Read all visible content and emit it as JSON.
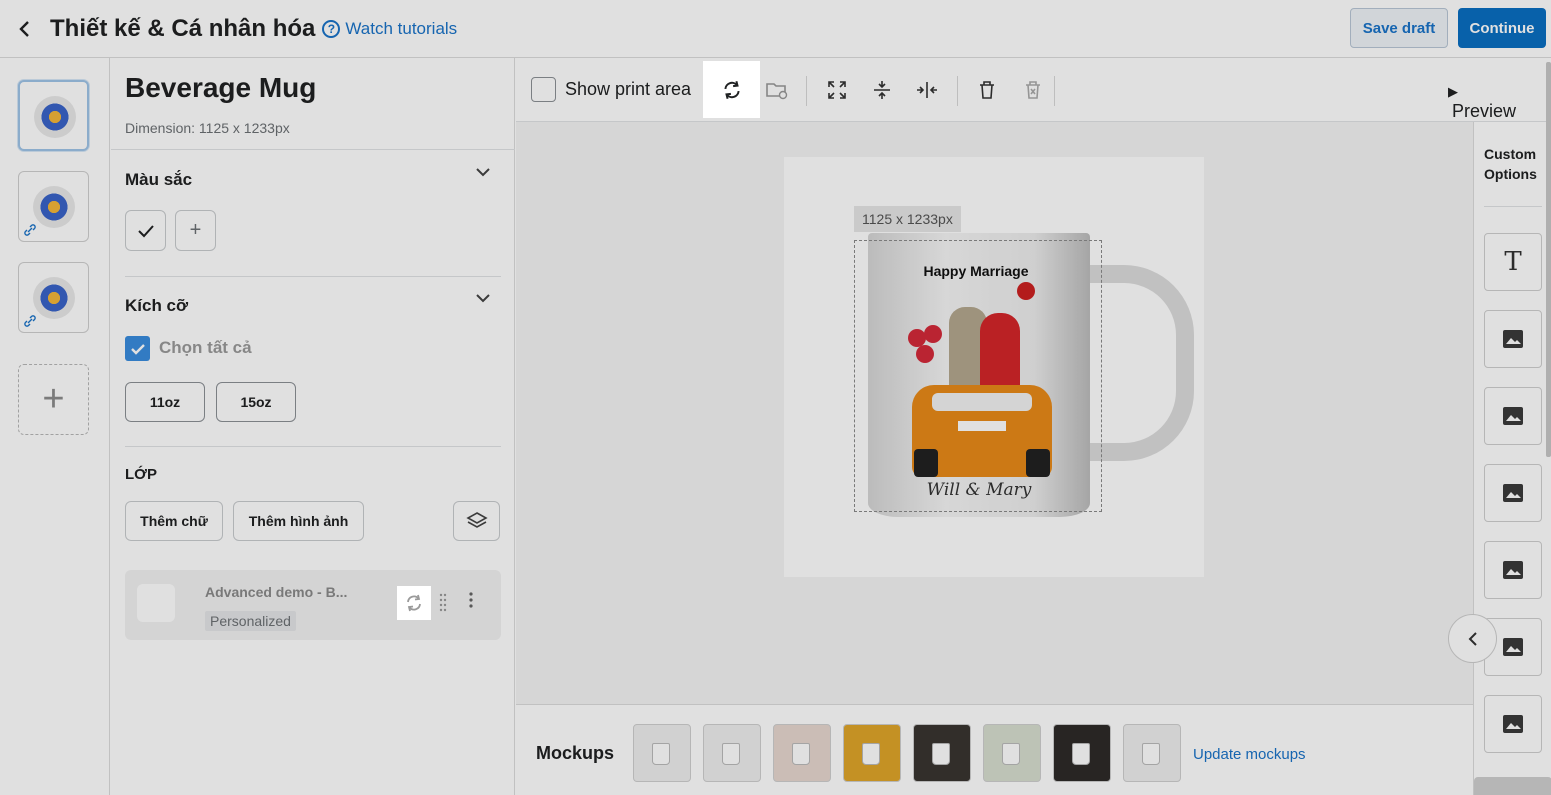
{
  "header": {
    "title": "Thiết kế & Cá nhân hóa",
    "help_icon": "question-circle-icon",
    "tutorials_label": "Watch tutorials",
    "save_draft_label": "Save draft",
    "continue_label": "Continue"
  },
  "product": {
    "name": "Beverage Mug",
    "dimension": "Dimension: 1125 x 1233px"
  },
  "color_section": {
    "title": "Màu sắc"
  },
  "size_section": {
    "title": "Kích cỡ",
    "select_all_label": "Chọn tất cả",
    "select_all_checked": true,
    "sizes": [
      "11oz",
      "15oz"
    ]
  },
  "layer_section": {
    "title": "LỚP",
    "add_text_label": "Thêm chữ",
    "add_image_label": "Thêm hình ảnh",
    "layers": [
      {
        "name": "Advanced demo - B...",
        "badge": "Personalized"
      }
    ]
  },
  "toolbar": {
    "show_print_area_label": "Show print area",
    "show_print_area_checked": false,
    "preview_label": "Preview"
  },
  "canvas": {
    "size_label": "1125 x 1233px",
    "art_title": "Happy Marriage",
    "art_signature": "Will & Mary"
  },
  "custom_options": {
    "title_line1": "Custom",
    "title_line2": "Options"
  },
  "mockups": {
    "label": "Mockups",
    "update_label": "Update mockups",
    "backgrounds": [
      "#eeeeee",
      "#eeeeee",
      "#e7d8d0",
      "#e0a62a",
      "#3a3530",
      "#d8dfd0",
      "#2e2b28",
      "#eeeeee"
    ]
  },
  "colors": {
    "accent": "#0a6fc2",
    "link": "#1a73c9",
    "checkbox": "#3a8dde"
  }
}
